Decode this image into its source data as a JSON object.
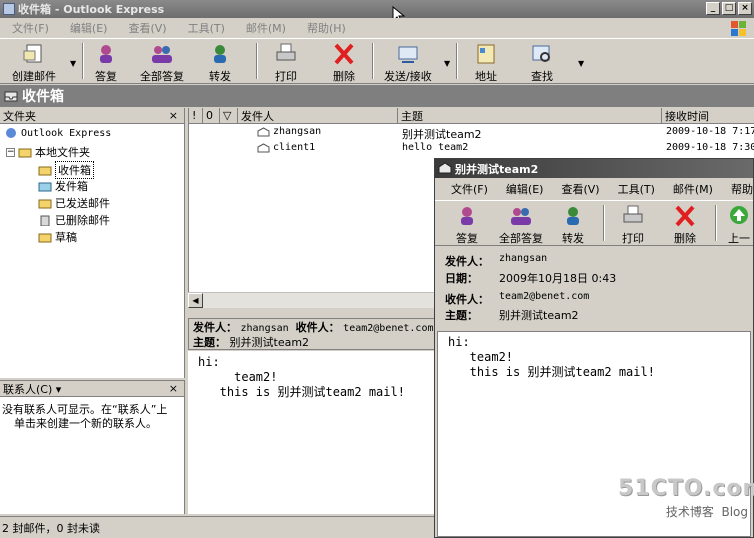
{
  "window": {
    "title": "收件箱 - Outlook Express",
    "minimize": "_",
    "maximize": "□",
    "close": "×"
  },
  "menu": [
    "文件(F)",
    "编辑(E)",
    "查看(V)",
    "工具(T)",
    "邮件(M)",
    "帮助(H)"
  ],
  "toolbar": {
    "create": "创建邮件",
    "reply": "答复",
    "reply_all": "全部答复",
    "forward": "转发",
    "print": "打印",
    "delete": "删除",
    "send_receive": "发送/接收",
    "addresses": "地址",
    "find": "查找"
  },
  "folder_bar": {
    "title": "收件箱"
  },
  "folder_pane": {
    "header": "文件夹",
    "close": "×",
    "root": "Outlook Express",
    "local": "本地文件夹",
    "folders": [
      "收件箱",
      "发件箱",
      "已发送邮件",
      "已删除邮件",
      "草稿"
    ]
  },
  "contacts_pane": {
    "header": "联系人(C) ▾",
    "close": "×",
    "text_line1": "没有联系人可显示。在“联系人”上",
    "text_line2": "单击来创建一个新的联系人。"
  },
  "message_list": {
    "columns": {
      "priority": "!",
      "attachment": "0",
      "flag": "▽",
      "from": "发件人",
      "subject": "主题",
      "received": "接收时间"
    },
    "rows": [
      {
        "from": "zhangsan",
        "subject": "别并测试team2",
        "received": "2009-10-18 7:17"
      },
      {
        "from": "client1",
        "subject": "hello team2",
        "received": "2009-10-18 7:30"
      }
    ]
  },
  "preview": {
    "from_label": "发件人：",
    "from": "zhangsan",
    "to_label": "收件人：",
    "to": "team2@benet.com",
    "subject_label": "主题：",
    "subject": "别并测试team2",
    "body": "hi:\n     team2!\n   this is 别并测试team2 mail!"
  },
  "status": {
    "text": "2 封邮件，0 封未读"
  },
  "message_window": {
    "title": "别并测试team2",
    "menu": [
      "文件(F)",
      "编辑(E)",
      "查看(V)",
      "工具(T)",
      "邮件(M)",
      "帮助"
    ],
    "toolbar": {
      "reply": "答复",
      "reply_all": "全部答复",
      "forward": "转发",
      "print": "打印",
      "delete": "删除",
      "previous": "上一"
    },
    "fields": {
      "from_label": "发件人：",
      "from": "zhangsan",
      "date_label": "日期：",
      "date": "2009年10月18日 0:43",
      "to_label": "收件人：",
      "to": "team2@benet.com",
      "subject_label": "主题：",
      "subject": "别并测试team2"
    },
    "body": "hi:\n   team2!\n   this is 别并测试team2 mail!"
  },
  "watermark": {
    "brand": "51CTO.com",
    "tagline": "技术博客",
    "blog": "Blog"
  }
}
